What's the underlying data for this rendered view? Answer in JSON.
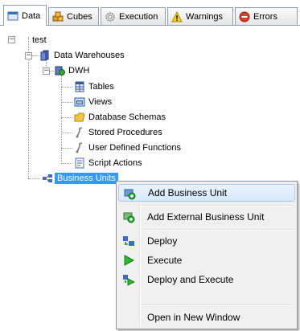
{
  "tabs": [
    {
      "label": "Data",
      "icon": "data-grid-icon",
      "active": true
    },
    {
      "label": "Cubes",
      "icon": "cubes-icon",
      "active": false
    },
    {
      "label": "Execution",
      "icon": "execution-gear-icon",
      "active": false
    },
    {
      "label": "Warnings",
      "icon": "warning-triangle-icon",
      "active": false
    },
    {
      "label": "Errors",
      "icon": "error-stop-icon",
      "active": false
    }
  ],
  "tree": {
    "root": "test",
    "data_warehouses": "Data Warehouses",
    "dwh": "DWH",
    "children": [
      {
        "label": "Tables",
        "icon": "table-icon"
      },
      {
        "label": "Views",
        "icon": "view-icon"
      },
      {
        "label": "Database Schemas",
        "icon": "folder-icon"
      },
      {
        "label": "Stored Procedures",
        "icon": "procedure-icon"
      },
      {
        "label": "User Defined Functions",
        "icon": "function-icon"
      },
      {
        "label": "Script Actions",
        "icon": "script-icon"
      }
    ],
    "business_units": "Business Units"
  },
  "menu": {
    "items": [
      {
        "label": "Add Business Unit",
        "icon": "add-business-unit-icon"
      },
      {
        "label": "Add External Business Unit",
        "icon": "add-external-business-unit-icon"
      },
      {
        "label": "Deploy",
        "icon": "deploy-icon"
      },
      {
        "label": "Execute",
        "icon": "execute-play-icon"
      },
      {
        "label": "Deploy and Execute",
        "icon": "deploy-execute-icon"
      },
      {
        "label": "Open in New Window",
        "icon": ""
      }
    ]
  },
  "colors": {
    "selection": "#3399ff",
    "menu_hover": "#d7e8fb",
    "execute_green": "#2fb52f"
  }
}
